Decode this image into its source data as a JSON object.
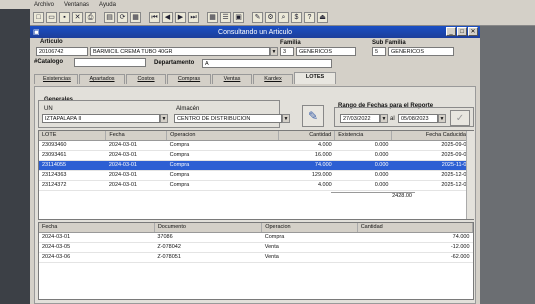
{
  "menu": [
    "Archivo",
    "Ventanas",
    "Ayuda"
  ],
  "window_title": "Consultando un Articulo",
  "articulo": {
    "label": "Articulo",
    "code": "20106742",
    "name": "BARMICIL CREMA TUBO 40GR"
  },
  "familia": {
    "label": "Familia",
    "code": "3",
    "name": "GENERICOS"
  },
  "subfamilia": {
    "label": "Sub Familia",
    "code": "5",
    "name": "GENERICOS"
  },
  "catalogo": {
    "label": "#Catalogo",
    "value": ""
  },
  "departamento": {
    "label": "Departamento",
    "value": "A"
  },
  "tabs": [
    "Existencias",
    "Apartados",
    "Costos",
    "Compras",
    "Ventas",
    "Kardex",
    "LOTES"
  ],
  "active_tab": "LOTES",
  "generales": {
    "label": "Generales",
    "un_label": "UN",
    "un_value": "IZTAPALAPA II",
    "almacen_label": "Almacén",
    "almacen_value": "CENTRO DE DISTRIBUCION"
  },
  "rango": {
    "label": "Rango de Fechas para el Reporte",
    "from": "27/03/2022",
    "al": "al",
    "to": "05/08/2023"
  },
  "lotes": {
    "headers": [
      "LOTE",
      "Fecha",
      "Operacion",
      "Cantidad",
      "Existencia",
      "Fecha Caducidad"
    ],
    "rows": [
      [
        "23093460",
        "2024-03-01",
        "Compra",
        "4.000",
        "0.000",
        "2025-09-01"
      ],
      [
        "23093461",
        "2024-03-01",
        "Compra",
        "16.000",
        "0.000",
        "2025-09-01"
      ],
      [
        "23114055",
        "2024-03-01",
        "Compra",
        "74.000",
        "0.000",
        "2025-11-01"
      ],
      [
        "23124363",
        "2024-03-01",
        "Compra",
        "129.000",
        "0.000",
        "2025-12-01"
      ],
      [
        "23124372",
        "2024-03-01",
        "Compra",
        "4.000",
        "0.000",
        "2025-12-01"
      ]
    ],
    "selected_row": 2,
    "total": "2428.00"
  },
  "detalle": {
    "headers": [
      "Fecha",
      "Documento",
      "Operacion",
      "Cantidad"
    ],
    "rows": [
      [
        "2024-03-01",
        "37086",
        "Compra",
        "74.000"
      ],
      [
        "2024-03-05",
        "Z-078042",
        "Venta",
        "-12.000"
      ],
      [
        "2024-03-06",
        "Z-078051",
        "Venta",
        "-62.000"
      ]
    ]
  },
  "colors": {
    "titlebar": "#1c3e9a",
    "selection": "#2d5fd3",
    "window_bg": "#d4d0c8"
  }
}
